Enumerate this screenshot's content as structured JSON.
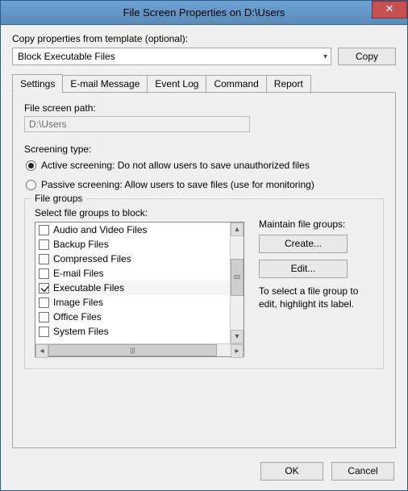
{
  "window": {
    "title": "File Screen Properties on D:\\Users",
    "close_glyph": "✕"
  },
  "template": {
    "label": "Copy properties from template (optional):",
    "selected": "Block Executable Files",
    "copy_label": "Copy"
  },
  "tabs": {
    "settings": "Settings",
    "email": "E-mail Message",
    "eventlog": "Event Log",
    "command": "Command",
    "report": "Report"
  },
  "settings": {
    "path_label": "File screen path:",
    "path_value": "D:\\Users",
    "screening_type_label": "Screening type:",
    "active_label": "Active screening: Do not allow users to save unauthorized files",
    "passive_label": "Passive screening: Allow users to save files (use for monitoring)",
    "screening_selected": "active",
    "file_groups_legend": "File groups",
    "select_groups_label": "Select file groups to block:",
    "items": [
      {
        "label": "Audio and Video Files",
        "checked": false
      },
      {
        "label": "Backup Files",
        "checked": false
      },
      {
        "label": "Compressed Files",
        "checked": false
      },
      {
        "label": "E-mail Files",
        "checked": false
      },
      {
        "label": "Executable Files",
        "checked": true
      },
      {
        "label": "Image Files",
        "checked": false
      },
      {
        "label": "Office Files",
        "checked": false
      },
      {
        "label": "System Files",
        "checked": false
      }
    ],
    "maintain_label": "Maintain file groups:",
    "create_label": "Create...",
    "edit_label": "Edit...",
    "hint": "To select a file group to edit, highlight its label."
  },
  "footer": {
    "ok": "OK",
    "cancel": "Cancel"
  }
}
